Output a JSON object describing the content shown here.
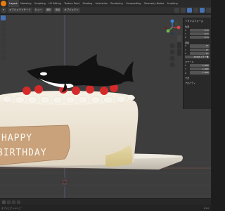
{
  "topbar": {
    "tabs": [
      "Layout",
      "Modeling",
      "Sculpting",
      "UV Editing",
      "Texture Paint",
      "Shading",
      "Animation",
      "Rendering",
      "Compositing",
      "Geometry Nodes",
      "Scripting"
    ],
    "active_tab_index": 0
  },
  "header": {
    "mode": "オブジェクトモード",
    "view_label": "ビュー",
    "select_label": "選択",
    "add_label": "追加",
    "object_label": "オブジェクト"
  },
  "npanel": {
    "title": "トランスフォーム",
    "location_label": "位置",
    "loc_x": "0 m",
    "loc_y": "0 m",
    "loc_z": "0 m",
    "rotation_label": "回転",
    "rot_x": "0°",
    "rot_y": "0°",
    "rot_z": "0°",
    "rot_mode": "XYZオイラー角",
    "scale_label": "スケール",
    "scale_x": "1.000",
    "scale_y": "1.000",
    "scale_z": "1.000",
    "dimensions_label": "寸法",
    "properties_label": "プロパティ"
  },
  "scene": {
    "plaque_line1": "HAPPY",
    "plaque_line2": "BIRTHDAY"
  },
  "status": {
    "text": "オブジェクトメニュー",
    "version": "3.3.0"
  },
  "colors": {
    "background": "#3d3d3d",
    "cake": "#ece4d6",
    "plate": "#d9d3c7",
    "strawberry": "#d62b2b",
    "plaque": "#c8a27a",
    "accent": "#e87d0d"
  }
}
